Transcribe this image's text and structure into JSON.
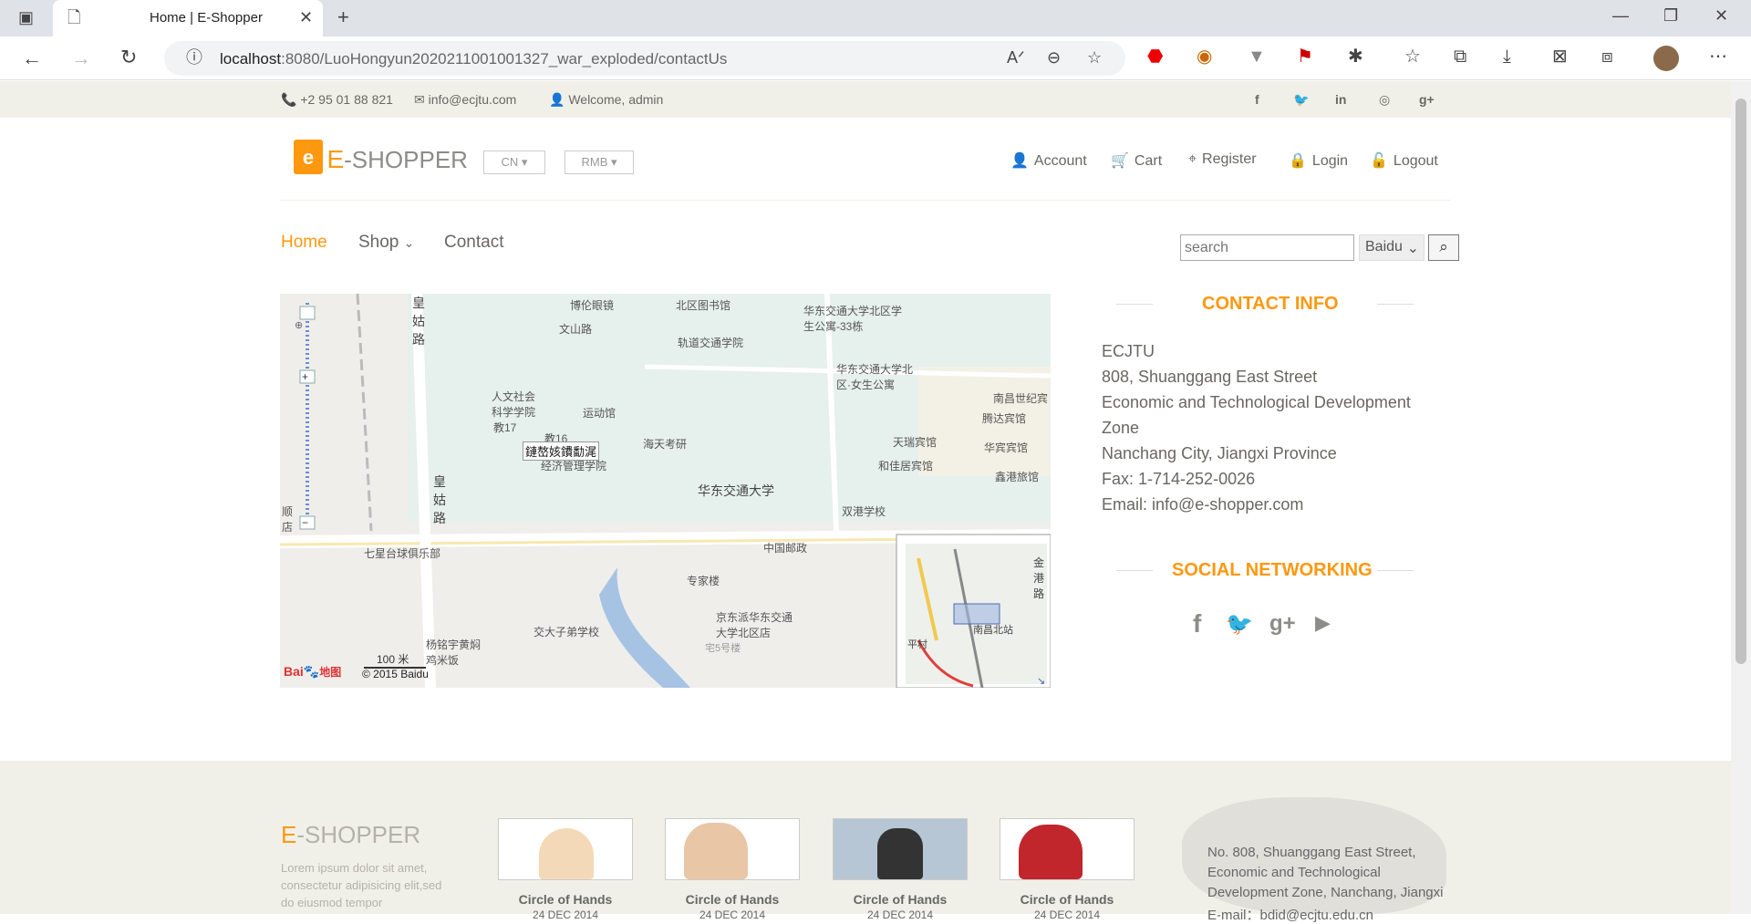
{
  "browser": {
    "tab_title": "Home | E-Shopper",
    "url_host": "localhost",
    "url_path": ":8080/LuoHongyun2020211001001327_war_exploded/contactUs"
  },
  "topbar": {
    "phone": "+2 95 01 88 821",
    "email": "info@ecjtu.com",
    "welcome": "Welcome, admin"
  },
  "header": {
    "logo_e": "E",
    "logo_rest": "-SHOPPER",
    "lang": "CN",
    "currency": "RMB",
    "account": "Account",
    "cart": "Cart",
    "register": "Register",
    "login": "Login",
    "logout": "Logout"
  },
  "nav": {
    "home": "Home",
    "shop": "Shop",
    "contact": "Contact",
    "search_placeholder": "search",
    "engine": "Baidu"
  },
  "map": {
    "labels": [
      "博伦眼镜",
      "北区图书馆",
      "华东交通大学北区学生公寓-33栋",
      "文山路",
      "轨道交通学院",
      "华东交通大学北区·女生公寓",
      "南昌世纪宾",
      "人文社会科学学院",
      "运动馆",
      "腾达宾馆",
      "教17",
      "教16",
      "海天考研",
      "天瑞宾馆",
      "华宾宾馆",
      "经济管理学院",
      "和佳居宾馆",
      "鑫港旅馆",
      "华东交通大学",
      "双港学校",
      "中国邮政",
      "七星台球俱乐部",
      "专家楼",
      "京东派华东交通大学北区店",
      "交大子弟学校",
      "杨铭宇黄焖鸡米饭",
      "宅5号楼",
      "皇姑路",
      "皇姑路",
      "顺店",
      "金港路",
      "南昌北站",
      "平村"
    ],
    "broken_img": "鏈嶅姟鐨勫浘",
    "scale": "100 米",
    "copyright": "© 2015 Baidu",
    "logo_text": "Bai",
    "logo_text2": "地图"
  },
  "contact": {
    "heading": "CONTACT INFO",
    "lines": [
      "ECJTU",
      "808, Shuanggang East Street",
      "Economic and Technological Development",
      "Zone",
      "Nanchang City, Jiangxi Province",
      "Fax: 1-714-252-0026",
      "Email: info@e-shopper.com"
    ],
    "social_heading": "SOCIAL NETWORKING"
  },
  "footer": {
    "logo_e": "E",
    "logo_rest": "-SHOPPER",
    "lorem": [
      "Lorem ipsum dolor sit amet,",
      "consectetur adipisicing elit,sed",
      "do eiusmod tempor"
    ],
    "items": [
      {
        "label": "Circle of Hands",
        "date": "24 DEC 2014"
      },
      {
        "label": "Circle of Hands",
        "date": "24 DEC 2014"
      },
      {
        "label": "Circle of Hands",
        "date": "24 DEC 2014"
      },
      {
        "label": "Circle of Hands",
        "date": "24 DEC 2014"
      }
    ],
    "address": [
      "No. 808, Shuanggang East Street,",
      "Economic and Technological",
      "Development Zone, Nanchang, Jiangxi",
      "E-mail：bdid@ecjtu.edu.cn"
    ]
  }
}
